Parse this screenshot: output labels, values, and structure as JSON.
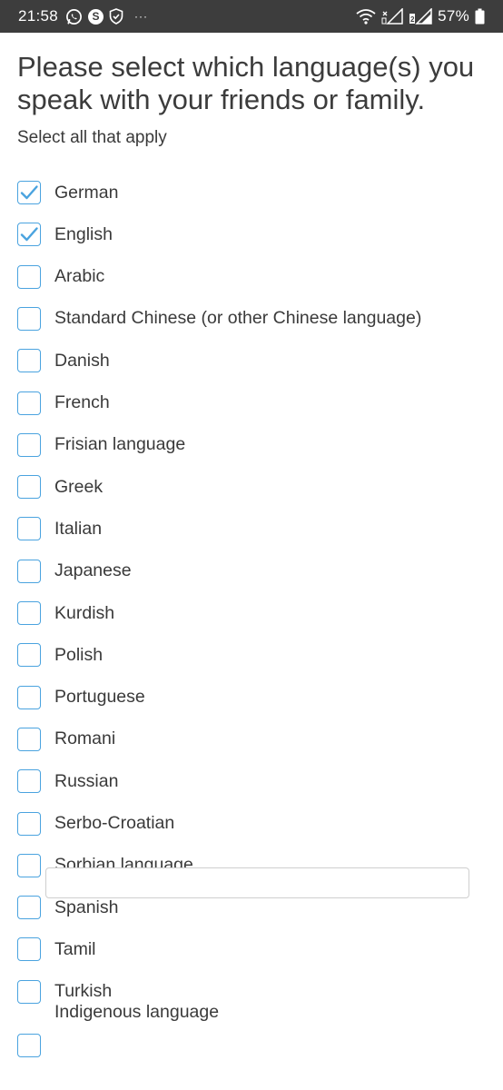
{
  "status_bar": {
    "time": "21:58",
    "icons_left": [
      "whatsapp-icon",
      "skype-icon",
      "shield-icon",
      "more-dots-icon"
    ],
    "skype_letter": "S",
    "more": "···",
    "icons_right": [
      "wifi-icon",
      "signal-icon-1",
      "signal-icon-2",
      "battery-icon"
    ],
    "battery_percent": "57%"
  },
  "question": {
    "title": "Please select which language(s) you speak with your friends or family.",
    "instruction": "Select all that apply"
  },
  "colors": {
    "checkbox_border": "#4aa3df",
    "checkmark": "#4aa3df",
    "status_bar_bg": "#3d3d3d"
  },
  "options": [
    {
      "label": "German",
      "checked": true
    },
    {
      "label": "English",
      "checked": true
    },
    {
      "label": "Arabic",
      "checked": false
    },
    {
      "label": "Standard Chinese (or other Chinese language)",
      "checked": false
    },
    {
      "label": "Danish",
      "checked": false
    },
    {
      "label": "French",
      "checked": false
    },
    {
      "label": "Frisian language",
      "checked": false
    },
    {
      "label": "Greek",
      "checked": false
    },
    {
      "label": "Italian",
      "checked": false
    },
    {
      "label": "Japanese",
      "checked": false
    },
    {
      "label": "Kurdish",
      "checked": false
    },
    {
      "label": "Polish",
      "checked": false
    },
    {
      "label": "Portuguese",
      "checked": false
    },
    {
      "label": "Romani",
      "checked": false
    },
    {
      "label": "Russian",
      "checked": false
    },
    {
      "label": "Serbo-Croatian",
      "checked": false
    },
    {
      "label": "Sorbian language",
      "checked": false
    },
    {
      "label": "Spanish",
      "checked": false
    },
    {
      "label": "Tamil",
      "checked": false
    },
    {
      "label": "Turkish",
      "checked": false
    }
  ],
  "other_option": {
    "label": "Indigenous language",
    "checked": false,
    "input_value": "",
    "input_placeholder": ""
  }
}
